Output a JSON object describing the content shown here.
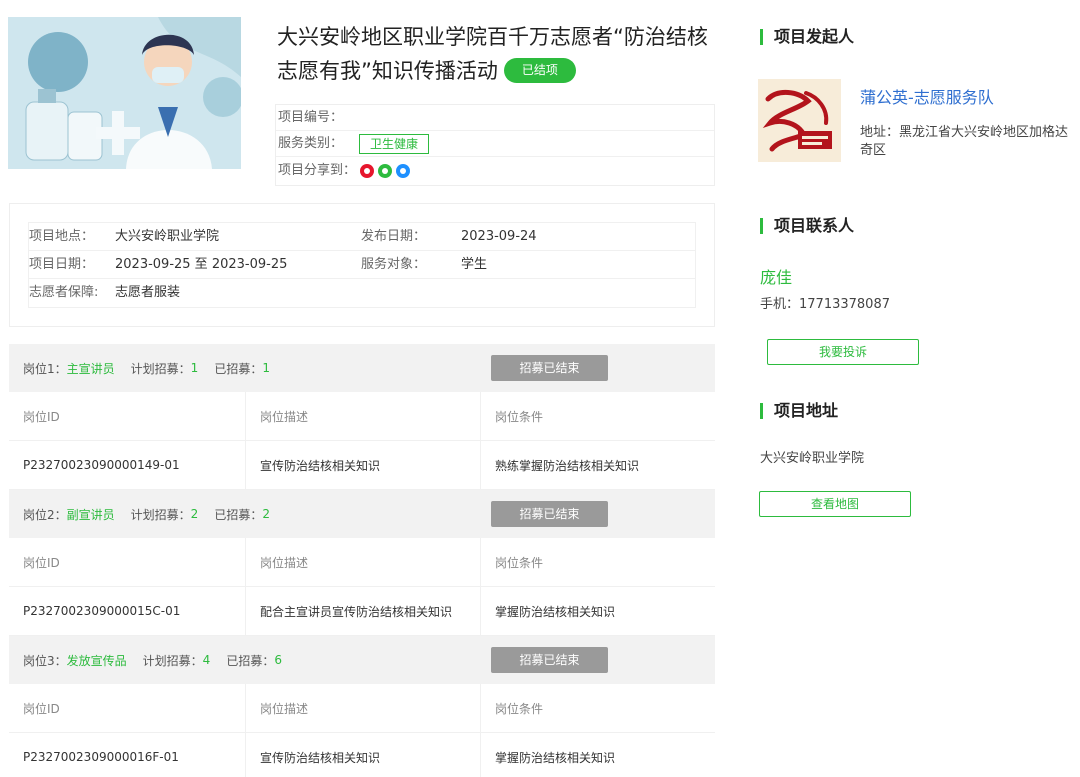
{
  "project": {
    "title_main": "大兴安岭地区职业学院百千万志愿者“防治结核 志愿有我”知识传播活动",
    "status_badge": "已结项",
    "number_label": "项目编号：",
    "number_value": "",
    "category_label": "服务类别：",
    "category_tag": "卫生健康",
    "share_label": "项目分享到："
  },
  "info": {
    "location_label": "项目地点：",
    "location_value": "大兴安岭职业学院",
    "publish_label": "发布日期：",
    "publish_value": "2023-09-24",
    "date_label": "项目日期：",
    "date_value": "2023-09-25 至 2023-09-25",
    "target_label": "服务对象：",
    "target_value": "学生",
    "guarantee_label": "志愿者保障:",
    "guarantee_value": "志愿者服装"
  },
  "positions": [
    {
      "prefix": "岗位1：",
      "name": "主宣讲员",
      "plan_label": "计划招募：",
      "plan_value": "1",
      "recruited_label": "已招募：",
      "recruited_value": "1",
      "status": "招募已结束",
      "col_id": "岗位ID",
      "col_desc": "岗位描述",
      "col_cond": "岗位条件",
      "id": "P23270023090000149-01",
      "desc": "宣传防治结核相关知识",
      "cond": "熟练掌握防治结核相关知识"
    },
    {
      "prefix": "岗位2：",
      "name": "副宣讲员",
      "plan_label": "计划招募：",
      "plan_value": "2",
      "recruited_label": "已招募：",
      "recruited_value": "2",
      "status": "招募已结束",
      "col_id": "岗位ID",
      "col_desc": "岗位描述",
      "col_cond": "岗位条件",
      "id": "P2327002309000015C-01",
      "desc": "配合主宣讲员宣传防治结核相关知识",
      "cond": "掌握防治结核相关知识"
    },
    {
      "prefix": "岗位3：",
      "name": "发放宣传品",
      "plan_label": "计划招募：",
      "plan_value": "4",
      "recruited_label": "已招募：",
      "recruited_value": "6",
      "status": "招募已结束",
      "col_id": "岗位ID",
      "col_desc": "岗位描述",
      "col_cond": "岗位条件",
      "id": "P2327002309000016F-01",
      "desc": "宣传防治结核相关知识",
      "cond": "掌握防治结核相关知识"
    }
  ],
  "side": {
    "initiator_title": "项目发起人",
    "org_name": "蒲公英-志愿服务队",
    "org_address": "地址：黑龙江省大兴安岭地区加格达奇区",
    "contact_title": "项目联系人",
    "contact_name": "庞佳",
    "contact_phone": "手机：17713378087",
    "complain_button": "我要投诉",
    "address_title": "项目地址",
    "address_value": "大兴安岭职业学院",
    "map_button": "查看地图"
  },
  "icons": {
    "weibo": "weibo-icon",
    "wechat": "wechat-icon",
    "qq": "qq-icon"
  },
  "colors": {
    "accent": "#2dbb3e",
    "link": "#2f6fd0",
    "disabled": "#9a9a9a"
  }
}
